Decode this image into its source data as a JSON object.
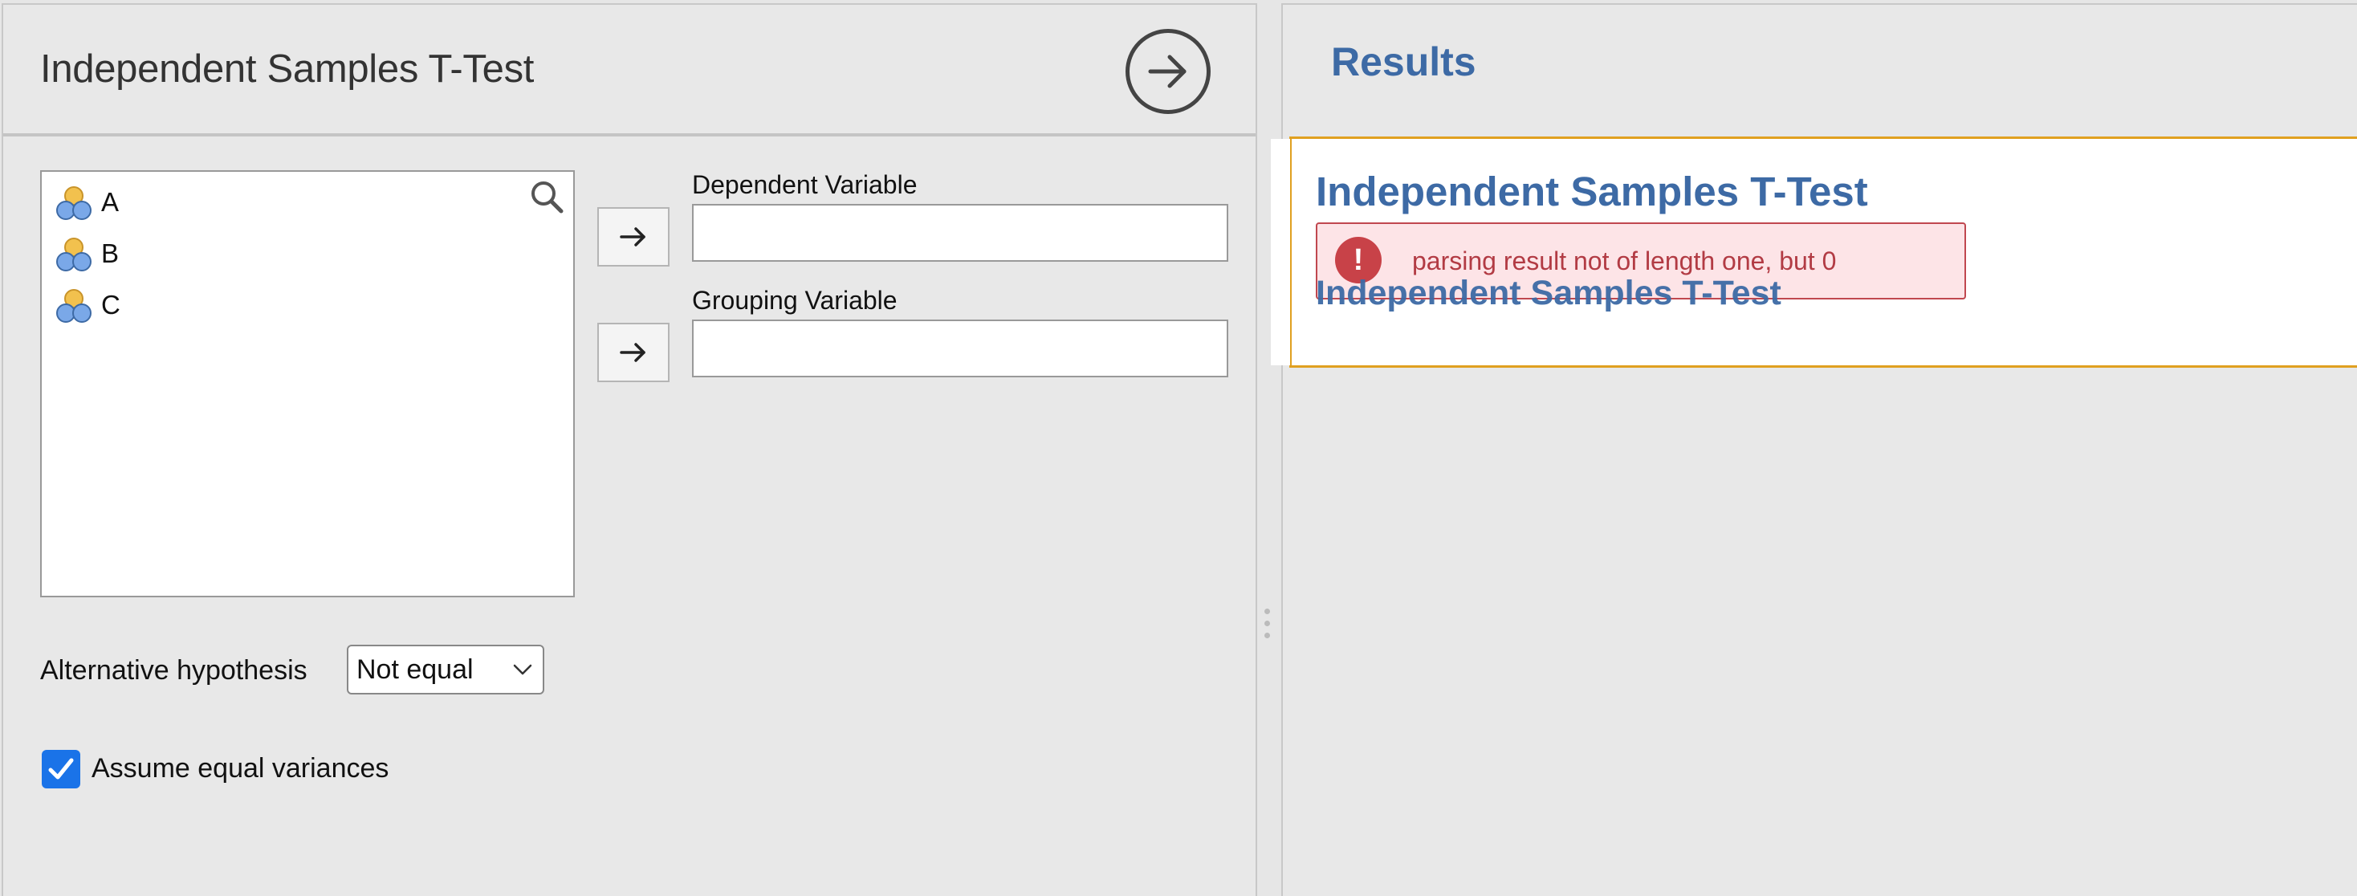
{
  "analysis_panel": {
    "title": "Independent Samples T-Test",
    "run_icon": "arrow-right-circle-icon",
    "variables": [
      {
        "label": "A",
        "icon": "nominal-variable-icon"
      },
      {
        "label": "B",
        "icon": "nominal-variable-icon"
      },
      {
        "label": "C",
        "icon": "nominal-variable-icon"
      }
    ],
    "search_icon": "search-icon",
    "dependent_label": "Dependent Variable",
    "dependent_value": "",
    "grouping_label": "Grouping Variable",
    "grouping_value": "",
    "alternative_label": "Alternative hypothesis",
    "alternative_selected": "Not equal",
    "equal_variances_label": "Assume equal variances",
    "equal_variances_checked": true
  },
  "results_panel": {
    "title": "Results",
    "card_title": "Independent Samples T-Test",
    "error_message": "parsing result not of length one, but 0",
    "error_icon_glyph": "!",
    "card_subtitle": "Independent Samples T-Test"
  },
  "colors": {
    "accent": "#3d6aa5",
    "error": "#c84248",
    "card_border": "#e0a020",
    "checkbox": "#1a73e8"
  }
}
